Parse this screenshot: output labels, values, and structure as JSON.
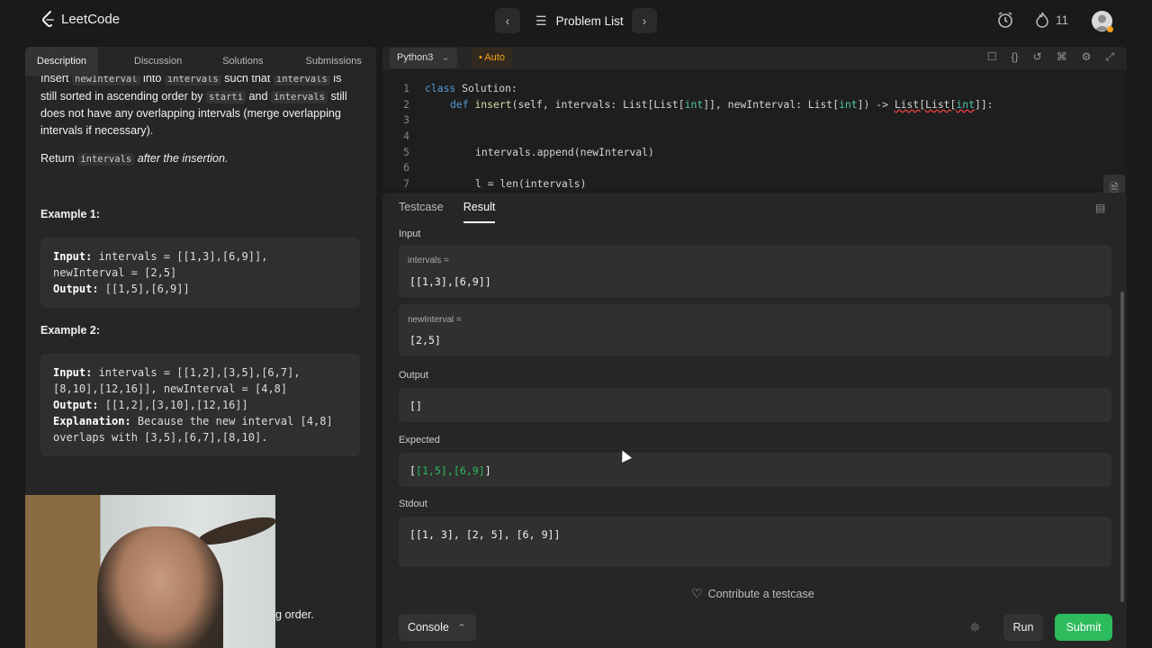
{
  "app": {
    "logo_text": "LeetCode",
    "problem_list_label": "Problem List",
    "streak_count": "11"
  },
  "left_tabs": {
    "description": "Description",
    "discussion": "Discussion",
    "solutions": "Solutions",
    "submissions": "Submissions"
  },
  "description": {
    "p1_a": "Insert ",
    "p1_code1": "newInterval",
    "p1_b": " into ",
    "p1_code2": "intervals",
    "p1_c": " such that ",
    "p1_code3": "intervals",
    "p1_d": " is still sorted in ascending order by ",
    "p1_code4": "starti",
    "p1_e": " and ",
    "p1_code5": "intervals",
    "p1_f": " still does not have any overlapping intervals (merge overlapping intervals if necessary).",
    "p2_a": "Return ",
    "p2_code": "intervals",
    "p2_b": " after the insertion.",
    "tail_text": "g order."
  },
  "examples": {
    "ex1_title": "Example 1:",
    "ex1_input_label": "Input:",
    "ex1_input": " intervals = [[1,3],[6,9]],",
    "ex1_input2": "newInterval = [2,5]",
    "ex1_output_label": "Output:",
    "ex1_output": " [[1,5],[6,9]]",
    "ex2_title": "Example 2:",
    "ex2_input_label": "Input:",
    "ex2_input": " intervals = [[1,2],[3,5],[6,7],",
    "ex2_input2": "[8,10],[12,16]], newInterval = [4,8]",
    "ex2_output_label": "Output:",
    "ex2_output": " [[1,2],[3,10],[12,16]]",
    "ex2_expl_label": "Explanation:",
    "ex2_expl": " Because the new interval [4,8]",
    "ex2_expl2": "overlaps with [3,5],[6,7],[8,10]."
  },
  "editor": {
    "language": "Python3",
    "auto_label": "Auto",
    "lines": [
      {
        "n": "1"
      },
      {
        "n": "2"
      },
      {
        "n": "3"
      },
      {
        "n": "4"
      },
      {
        "n": "5"
      },
      {
        "n": "6"
      },
      {
        "n": "7"
      }
    ],
    "l1_kw": "class",
    "l1_rest": " Solution:",
    "l2_kw": "def",
    "l2_fn": "insert",
    "l2_a": "(self, intervals: List[List[",
    "l2_t1": "int",
    "l2_b": "]], newInterval: List[",
    "l2_t2": "int",
    "l2_c": "]) -> ",
    "l2_ret": "List[List[",
    "l2_t3": "int",
    "l2_d": "]]:",
    "l5": "intervals.append(newInterval)",
    "l7": "l = len(intervals)"
  },
  "result_tabs": {
    "testcase": "Testcase",
    "result": "Result"
  },
  "result": {
    "input_label": "Input",
    "intervals_name": "intervals =",
    "intervals_value": "[[1,3],[6,9]]",
    "newinterval_name": "newInterval =",
    "newinterval_value": "[2,5]",
    "output_label": "Output",
    "output_value": "[]",
    "expected_label": "Expected",
    "expected_open": "[",
    "expected_inner": "[1,5],[6,9]",
    "expected_close": "]",
    "stdout_label": "Stdout",
    "stdout_value": "[[1, 3], [2, 5], [6, 9]]",
    "contribute": "Contribute a testcase"
  },
  "footer": {
    "console": "Console",
    "run": "Run",
    "submit": "Submit"
  },
  "colors": {
    "accent_green": "#2cbb5d",
    "accent_orange": "#f7a21b"
  }
}
